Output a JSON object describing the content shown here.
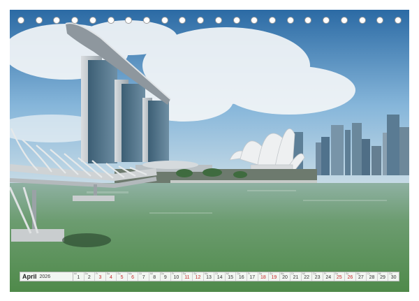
{
  "calendar": {
    "month": "April",
    "year": "2026",
    "weekday_abbr": [
      "Mi",
      "Do",
      "Fr",
      "Sa",
      "So",
      "Mo",
      "Di",
      "Mi",
      "Do",
      "Fr",
      "Sa",
      "So",
      "Mo",
      "Di",
      "Mi",
      "Do",
      "Fr",
      "Sa",
      "So",
      "Mo",
      "Di",
      "Mi",
      "Do",
      "Fr",
      "Sa",
      "So",
      "Mo",
      "Di",
      "Mi",
      "Do"
    ],
    "days": [
      "1",
      "2",
      "3",
      "4",
      "5",
      "6",
      "7",
      "8",
      "9",
      "10",
      "11",
      "12",
      "13",
      "14",
      "15",
      "16",
      "17",
      "18",
      "19",
      "20",
      "21",
      "22",
      "23",
      "24",
      "25",
      "26",
      "27",
      "28",
      "29",
      "30"
    ],
    "highlighted_days": [
      3,
      4,
      5,
      6,
      11,
      12,
      18,
      19,
      25,
      26
    ]
  },
  "binding": {
    "hole_count": 22
  },
  "colors": {
    "sky_top": "#2f6fa8",
    "sky_mid": "#7fb0d6",
    "water": "#6f9f6e",
    "highlight_day": "#c62828"
  }
}
